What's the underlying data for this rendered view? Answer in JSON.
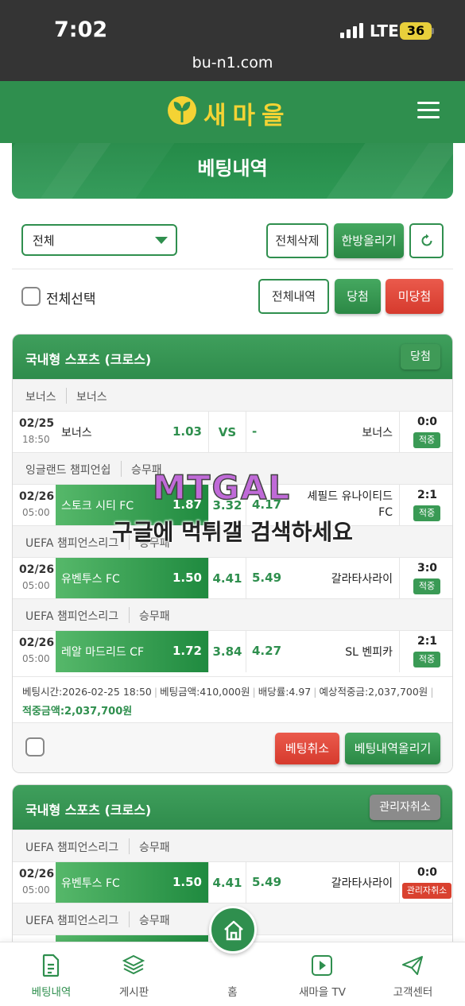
{
  "status_bar": {
    "time": "7:02",
    "network": "LTE",
    "battery": "36"
  },
  "browser": {
    "url": "bu-n1.com"
  },
  "header": {
    "logo_text": "새마을"
  },
  "banner": {
    "title": "베팅내역"
  },
  "filters": {
    "select_value": "전체",
    "delete_all": "전체삭제",
    "upload_all": "한방올리기",
    "select_all": "전체선택",
    "all_history": "전체내역",
    "won": "당첨",
    "not_won": "미당첨"
  },
  "cards": [
    {
      "title": "국내형 스포츠 (크로스)",
      "badge": "당첨",
      "bets": [
        {
          "league": "보너스",
          "market": "보너스",
          "date": "02/25",
          "time": "18:50",
          "home": "보너스",
          "home_odds": "1.03",
          "draw": "VS",
          "away_odds": "-",
          "away": "보너스",
          "score": "0:0",
          "status": "적중"
        },
        {
          "league": "잉글랜드 챔피언쉽",
          "market": "승무패",
          "date": "02/26",
          "time": "05:00",
          "home": "스토크 시티 FC",
          "home_odds": "1.87",
          "draw": "3.32",
          "away_odds": "4.17",
          "away": "셰필드 유나이티드 FC",
          "score": "2:1",
          "status": "적중"
        },
        {
          "league": "UEFA 챔피언스리그",
          "market": "승무패",
          "date": "02/26",
          "time": "05:00",
          "home": "유벤투스 FC",
          "home_odds": "1.50",
          "draw": "4.41",
          "away_odds": "5.49",
          "away": "갈라타사라이",
          "score": "3:0",
          "status": "적중"
        },
        {
          "league": "UEFA 챔피언스리그",
          "market": "승무패",
          "date": "02/26",
          "time": "05:00",
          "home": "레알 마드리드 CF",
          "home_odds": "1.72",
          "draw": "3.84",
          "away_odds": "4.27",
          "away": "SL 벤피카",
          "score": "2:1",
          "status": "적중"
        }
      ],
      "summary": {
        "bet_time": "베팅시간:2026-02-25 18:50",
        "bet_amount": "베팅금액:410,000원",
        "odds": "배당률:4.97",
        "expected": "예상적중금:2,037,700원",
        "won_amount": "적중금액:2,037,700원"
      },
      "cancel_btn": "베팅취소",
      "upload_btn": "베팅내역올리기"
    },
    {
      "title": "국내형 스포츠 (크로스)",
      "badge": "관리자취소",
      "bets": [
        {
          "league": "UEFA 챔피언스리그",
          "market": "승무패",
          "date": "02/26",
          "time": "05:00",
          "home": "유벤투스 FC",
          "home_odds": "1.50",
          "draw": "4.41",
          "away_odds": "5.49",
          "away": "갈라타사라이",
          "score": "0:0",
          "status": "관리자취소"
        },
        {
          "league": "UEFA 챔피언스리그",
          "market": "승무패"
        }
      ]
    }
  ],
  "watermark": {
    "logo": "MTGAL",
    "text": "구글에 먹튀갤 검색하세요"
  },
  "bottom_nav": {
    "items": [
      {
        "label": "베팅내역",
        "icon": "document-icon"
      },
      {
        "label": "게시판",
        "icon": "layers-icon"
      },
      {
        "label": "홈",
        "icon": "home-icon"
      },
      {
        "label": "새마을 TV",
        "icon": "play-icon"
      },
      {
        "label": "고객센터",
        "icon": "send-icon"
      }
    ]
  },
  "colors": {
    "primary": "#2f8f4e",
    "danger": "#d9412f",
    "status_bar": "#343434"
  }
}
